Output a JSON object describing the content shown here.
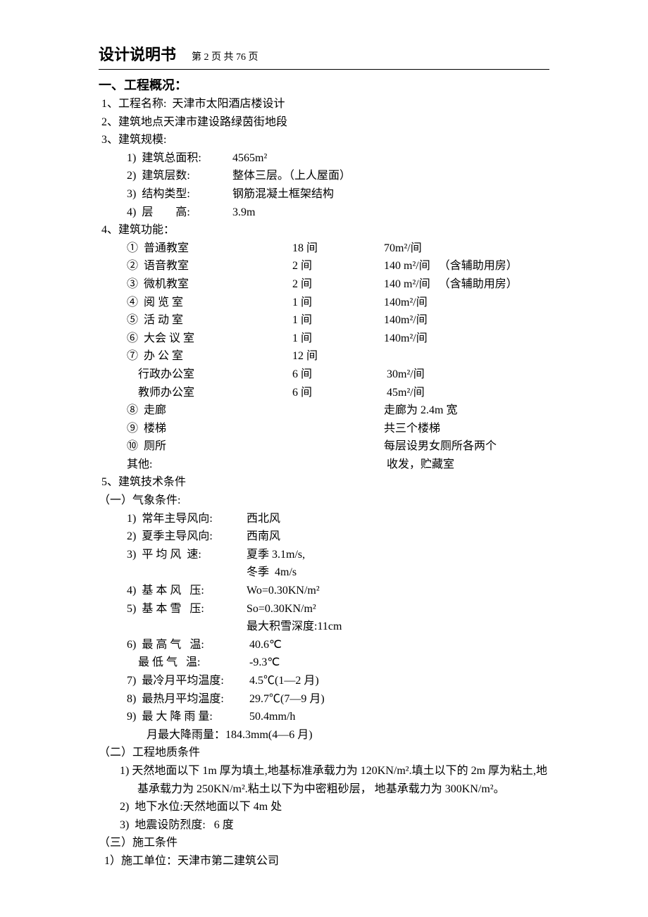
{
  "header": {
    "title": "设计说明书",
    "pageinfo": "第 2 页  共 76 页"
  },
  "section1_title": "一、工程概况：",
  "l1": " 1、工程名称:  天津市太阳酒店楼设计",
  "l2": " 2、建筑地点天津市建设路绿茵街地段",
  "l3": " 3、建筑规模:",
  "l3_1a": "1)  建筑总面积:",
  "l3_1b": "4565m²",
  "l3_2a": "2)  建筑层数:",
  "l3_2b": "整体三层。（上人屋面）",
  "l3_3a": "3)  结构类型:",
  "l3_3b": "钢筋混凝土框架结构",
  "l3_4a": "4)  层        高:",
  "l3_4b": "3.9m",
  "l4": " 4、建筑功能：",
  "f1": {
    "a": "①  普通教室",
    "b": "18 间",
    "c": "70m²/间"
  },
  "f2": {
    "a": "②  语音教室",
    "b": "2 间",
    "c": "140 m²/间   （含辅助用房）"
  },
  "f3": {
    "a": "③  微机教室",
    "b": "2 间",
    "c": "140 m²/间   （含辅助用房）"
  },
  "f4": {
    "a": "④  阅 览 室",
    "b": "1 间",
    "c": "140m²/间"
  },
  "f5": {
    "a": "⑤  活 动 室",
    "b": "1 间",
    "c": "140m²/间"
  },
  "f6": {
    "a": "⑥  大会 议 室",
    "b": "1 间",
    "c": "140m²/间"
  },
  "f7": {
    "a": "⑦  办 公 室",
    "b": "12 间",
    "c": ""
  },
  "f7a": {
    "a": "    行政办公室",
    "b": "6 间",
    "c": " 30m²/间"
  },
  "f7b": {
    "a": "    教师办公室",
    "b": "6 间",
    "c": " 45m²/间"
  },
  "f8": {
    "a": "⑧  走廊",
    "b": "",
    "c": "走廊为 2.4m 宽"
  },
  "f9": {
    "a": "⑨  楼梯",
    "b": "",
    "c": "共三个楼梯"
  },
  "f10": {
    "a": "⑩  厕所",
    "b": "",
    "c": "每层设男女厕所各两个"
  },
  "f11": {
    "a": "其他:",
    "b": "",
    "c": " 收发，贮藏室"
  },
  "l5": " 5、建筑技术条件",
  "l5_1": "（一）气象条件:",
  "w1": {
    "a": "1)  常年主导风向:",
    "b": "西北风"
  },
  "w2": {
    "a": "2)  夏季主导风向:",
    "b": "西南风"
  },
  "w3": {
    "a": "3)  平 均 风  速:",
    "b": "夏季 3.1m/s,"
  },
  "w3b": {
    "a": "",
    "b": "冬季  4m/s"
  },
  "w4": {
    "a": "4)  基 本 风   压:",
    "b": "Wo=0.30KN/m²"
  },
  "w5": {
    "a": "5)  基 本 雪   压:",
    "b": "So=0.30KN/m²"
  },
  "w5b": {
    "a": "",
    "b": "最大积雪深度:11cm"
  },
  "w6": {
    "a": "6)  最 高 气   温:",
    "b": " 40.6℃"
  },
  "w6b": {
    "a": "    最 低 气   温:",
    "b": " -9.3℃"
  },
  "w7": {
    "a": "7)  最冷月平均温度:",
    "b": " 4.5℃(1—2 月)"
  },
  "w8": {
    "a": "8)  最热月平均温度:",
    "b": " 29.7℃(7—9 月)"
  },
  "w9": {
    "a": "9)  最 大 降 雨 量:",
    "b": " 50.4mm/h"
  },
  "w9b": "       月最大降雨量：184.3mm(4—6 月)",
  "l5_2": "（二）工程地质条件",
  "g1": "1)  天然地面以下 1m 厚为填土,地基标准承载力为 120KN/m².填土以下的 2m 厚为粘土,地基承载力为 250KN/m².粘土以下为中密粗砂层， 地基承载力为 300KN/m²。",
  "g2": "2)  地下水位:天然地面以下 4m 处",
  "g3": "3)  地震设防烈度:   6 度",
  "l5_3": "（三）施工条件",
  "c1": "  1）施工单位：天津市第二建筑公司"
}
